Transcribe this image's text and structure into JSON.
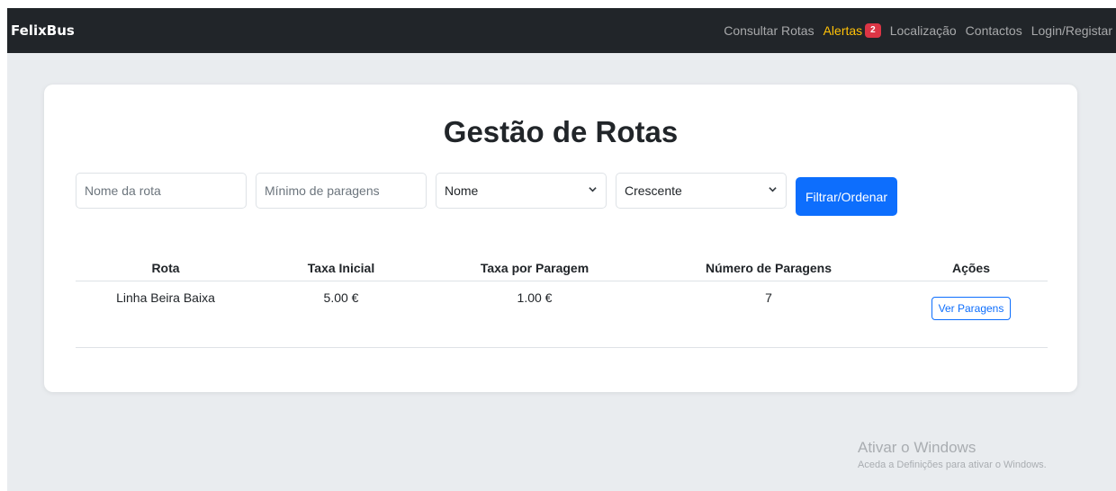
{
  "navbar": {
    "brand": "FelixBus",
    "links": {
      "consultar_rotas": "Consultar Rotas",
      "alertas": "Alertas",
      "alertas_count": "2",
      "localizacao": "Localização",
      "contactos": "Contactos",
      "login": "Login/Registar"
    }
  },
  "page": {
    "title": "Gestão de Rotas"
  },
  "filters": {
    "nome_placeholder": "Nome da rota",
    "min_paragens_placeholder": "Mínimo de paragens",
    "sort_field_value": "Nome",
    "sort_order_value": "Crescente",
    "submit_label": "Filtrar/Ordenar"
  },
  "table": {
    "headers": [
      "Rota",
      "Taxa Inicial",
      "Taxa por Paragem",
      "Número de Paragens",
      "Ações"
    ],
    "rows": [
      {
        "rota": "Linha Beira Baixa",
        "taxa_inicial": "5.00 €",
        "taxa_paragem": "1.00 €",
        "num_paragens": "7",
        "action_label": "Ver Paragens"
      }
    ]
  },
  "watermark": {
    "title": "Ativar o Windows",
    "subtitle": "Aceda a Definições para ativar o Windows."
  },
  "colors": {
    "navbar_bg": "#212529",
    "alert_link": "#ffc107",
    "badge_bg": "#dc3545",
    "primary": "#0d6efd",
    "page_bg": "#e9ecef"
  }
}
